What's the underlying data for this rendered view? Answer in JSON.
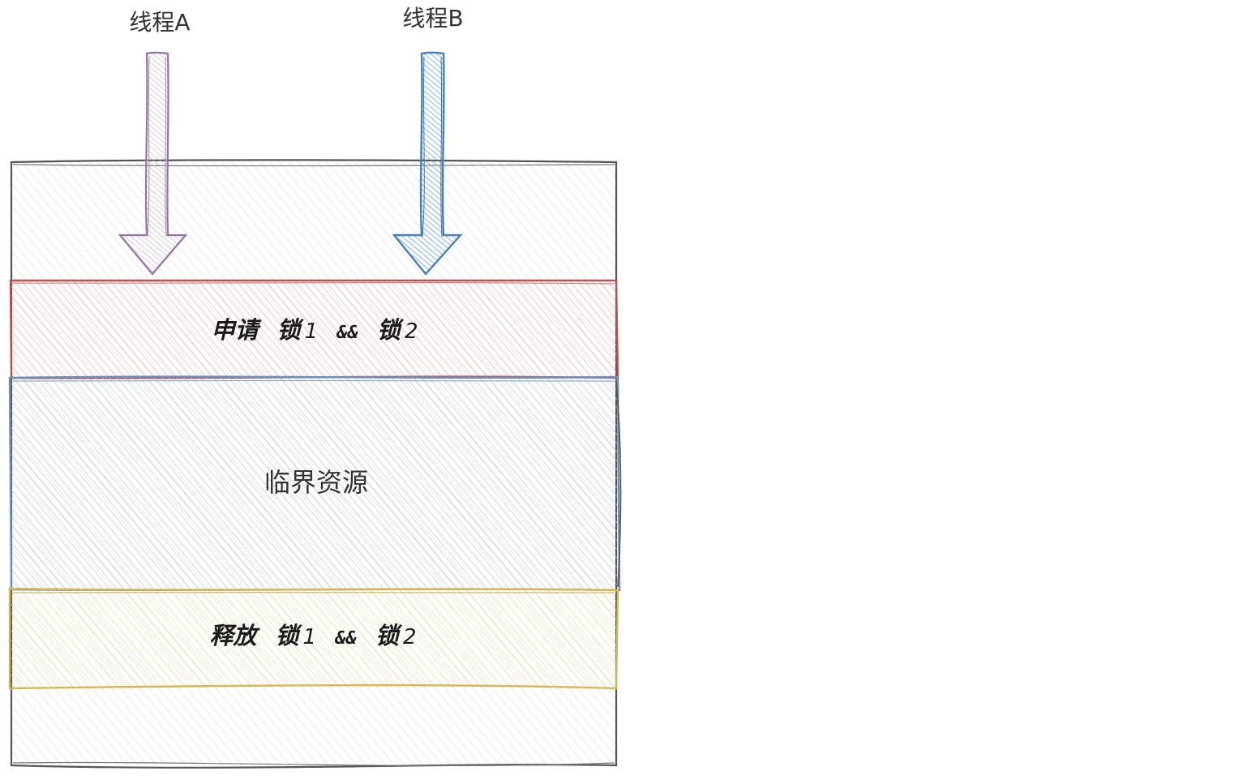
{
  "threads": {
    "a": {
      "label": "线程A",
      "color": "#9673a6",
      "fill": "#e1d5e7"
    },
    "b": {
      "label": "线程B",
      "color": "#4a7fb5",
      "fill": "#5b9bd5"
    }
  },
  "container": {
    "stroke": "#555555",
    "hatch": "#d9d9d9"
  },
  "bands": {
    "acquire": {
      "word": "申请",
      "lock1": "锁",
      "num1": "1",
      "op": "&&",
      "lock2": "锁",
      "num2": "2",
      "stroke": "#b85450",
      "hatch": "#f1b7b3"
    },
    "critical": {
      "label": "临界资源",
      "stroke": "#6c8ebf",
      "hatch": "#b9cbe8"
    },
    "release": {
      "word": "释放",
      "lock1": "锁",
      "num1": "1",
      "op": "&&",
      "lock2": "锁",
      "num2": "2",
      "stroke": "#d6b656",
      "hatch": "#f3e2a6"
    }
  }
}
